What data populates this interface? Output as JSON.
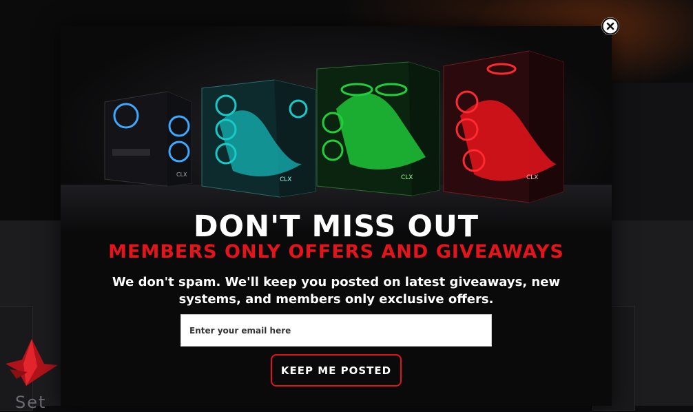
{
  "background": {
    "partial_text": "Set"
  },
  "modal": {
    "headline": "DON'T MISS OUT",
    "subheadline": "MEMBERS ONLY OFFERS AND GIVEAWAYS",
    "body": "We don't spam. We'll keep you posted on latest giveaways, new systems, and members only exclusive offers.",
    "email_placeholder": "Enter your email here",
    "email_value": "",
    "submit_label": "KEEP ME POSTED",
    "hero_case_labels": [
      "CLX",
      "CLX",
      "CLX",
      "CLX"
    ],
    "hero_case_colors": [
      "#3da8ff",
      "#17c9c9",
      "#1fd03a",
      "#e8141c"
    ]
  },
  "icons": {
    "close": "close-circle-icon",
    "logo": "clx-logo-icon"
  },
  "colors": {
    "accent_red": "#e3141b",
    "modal_bg": "#0a0a0b",
    "text": "#ffffff"
  }
}
